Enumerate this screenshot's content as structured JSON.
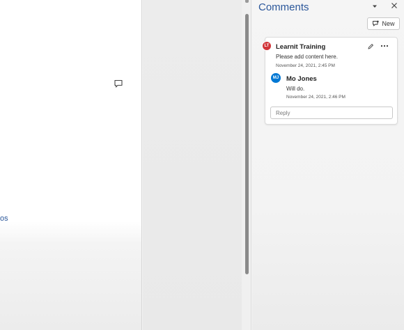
{
  "document": {
    "fragment_text": "os",
    "comment_marker_icon": "comment-bubble-icon"
  },
  "pane": {
    "title": "Comments",
    "options_icon": "triangle-down-icon",
    "close_icon": "close-icon",
    "new_button": {
      "label": "New",
      "icon": "new-comment-icon"
    }
  },
  "thread": {
    "comment": {
      "initials": "LT",
      "author": "Learnit Training",
      "text": "Please add content here.",
      "timestamp": "November 24, 2021, 2:45 PM",
      "avatar_color": "#d13438",
      "edit_icon": "pencil-icon",
      "more_icon": "more-options-icon"
    },
    "reply": {
      "initials": "MJ",
      "author": "Mo Jones",
      "text": "Will do.",
      "timestamp": "November 24, 2021, 2:46 PM",
      "avatar_color": "#0078d4"
    },
    "reply_placeholder": "Reply"
  },
  "colors": {
    "accent": "#2b579a"
  }
}
